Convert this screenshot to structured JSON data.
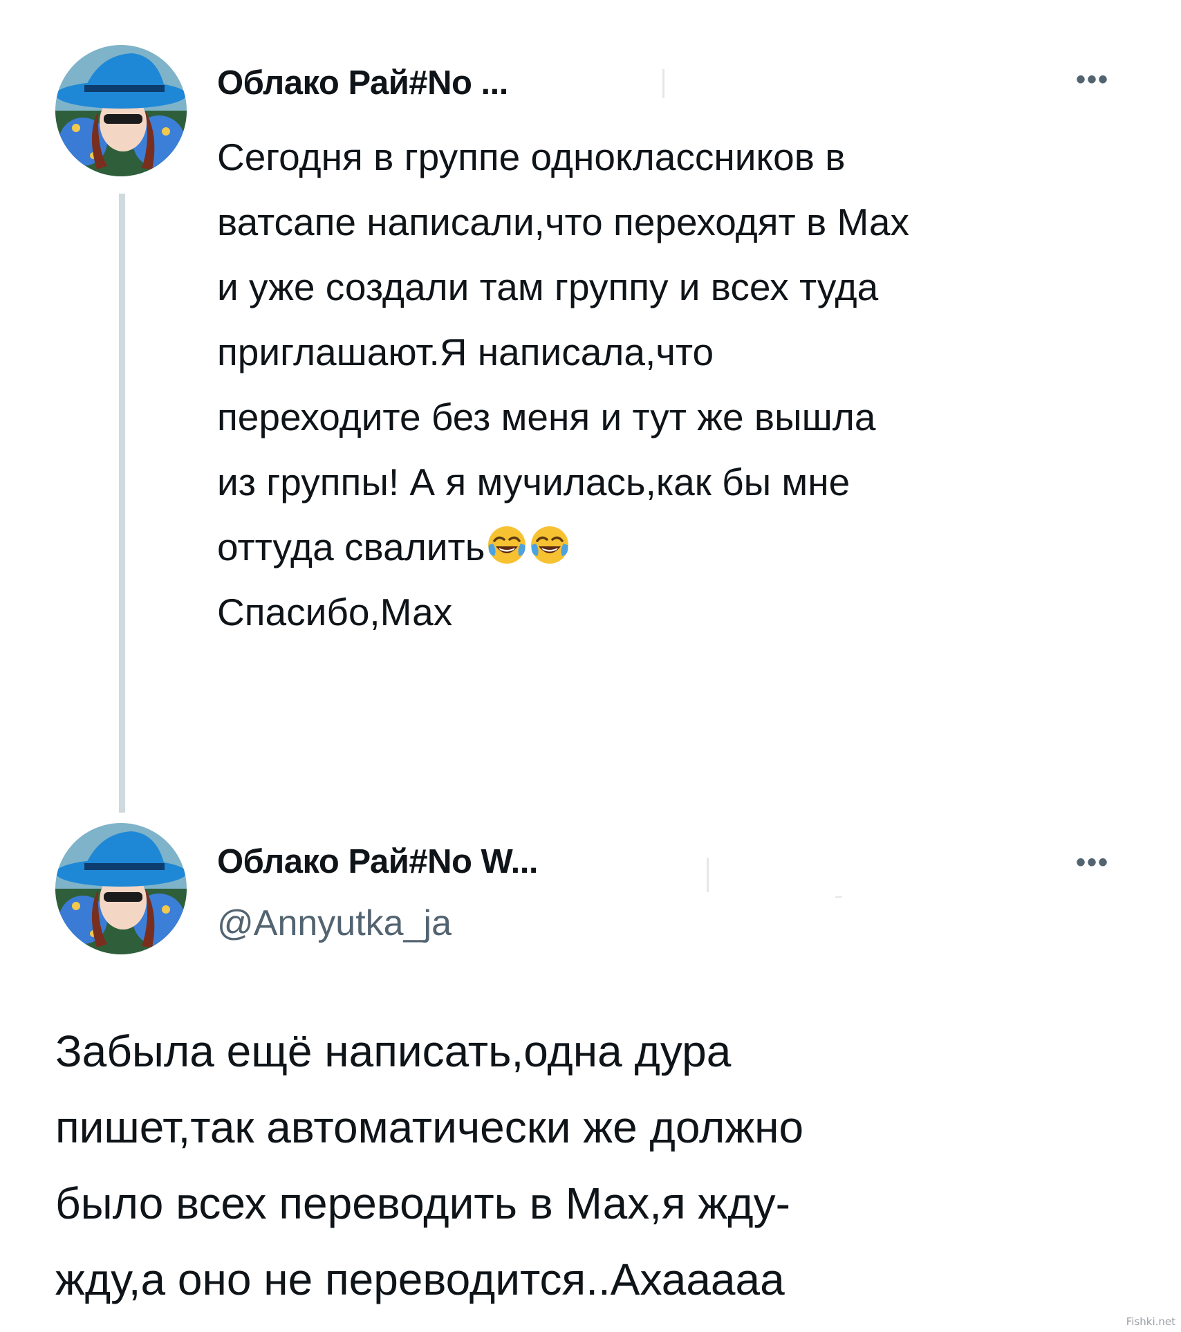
{
  "tweet": {
    "author_name": "Облако Рай#No ...",
    "more_label": "•••",
    "lines": [
      "Сегодня в  группе одноклассников в",
      "ватсапе написали,что переходят в Мах",
      "и уже создали там группу и всех туда",
      "приглашают.Я написала,что",
      "переходите без меня и тут же вышла",
      "из группы!  А я мучилась,как бы мне",
      "оттуда свалить",
      "Спасибо,Мах"
    ],
    "emoji": "face-with-tears-of-joy"
  },
  "reply": {
    "author_name": "Облако Рай#No W...",
    "handle": "@Annyutka_ja",
    "more_label": "•••",
    "lines": [
      "Забыла ещё написать,одна дура",
      "пишет,так автоматически же должно",
      "было всех переводить в Мах,я жду-",
      "жду,а оно не переводится..Ахааааа"
    ]
  },
  "watermark": "Fishki.net",
  "colors": {
    "text": "#0f1419",
    "secondary": "#536471",
    "thread_line": "#cfd9de",
    "hat_blue": "#1e88d6"
  }
}
